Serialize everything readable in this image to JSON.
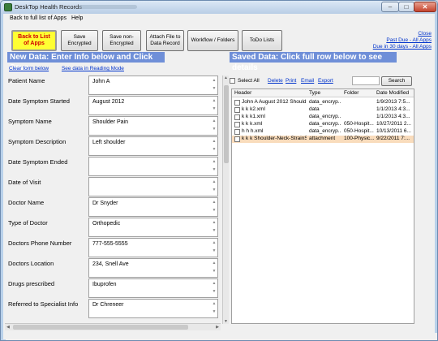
{
  "window": {
    "title": "DeskTop Health Records",
    "controls": {
      "minimize": "–",
      "maximize": "□",
      "close": "✕"
    }
  },
  "menu": [
    {
      "label": "Back to full list of Apps"
    },
    {
      "label": "Help"
    }
  ],
  "toolbar": {
    "back": "Back to List of Apps",
    "save_encrypted": "Save Encrypted",
    "save_non_encrypted": "Save non-Encrypted",
    "attach": "Attach File to Data Record",
    "workflow": "Workflow / Folders",
    "todo": "ToDo Lists"
  },
  "right_links": {
    "close": "Close",
    "past_due": "Past Due - All Apps",
    "due_30": "Due in 30 days - All Apps"
  },
  "new_data": {
    "banner": "New Data: Enter Info below and Click Save.",
    "clear_form": "Clear form below",
    "reading_mode": "See data in Reading Mode",
    "fields": [
      {
        "label": "Patient Name",
        "value": "John A"
      },
      {
        "label": "Date Symptom Started",
        "value": "August 2012"
      },
      {
        "label": "Symptom Name",
        "value": "Shoulder Pain"
      },
      {
        "label": "Symptom Description",
        "value": "Left shoulder"
      },
      {
        "label": "Date  Symptom Ended",
        "value": ""
      },
      {
        "label": "Date of Visit",
        "value": ""
      },
      {
        "label": "Doctor Name",
        "value": "Dr Snyder"
      },
      {
        "label": "Type of Doctor",
        "value": "Orthopedic"
      },
      {
        "label": "Doctors Phone Number",
        "value": "777-555-5555"
      },
      {
        "label": "Doctors Location",
        "value": "234, Snell Ave"
      },
      {
        "label": "Drugs prescribed",
        "value": "Ibuprofen"
      },
      {
        "label": "Referred to Specialist Info",
        "value": "Dr Chreneer"
      }
    ]
  },
  "saved_data": {
    "banner": "Saved Data: Click full row below to see details",
    "select_all": "Select All",
    "delete": "Delete",
    "print": "Print",
    "email": "Email",
    "export": "Export",
    "search_placeholder": "",
    "search_button": "Search",
    "columns": [
      "Header",
      "Type",
      "Folder",
      "Date Modified"
    ],
    "rows": [
      {
        "header": "John A August 2012 Should...",
        "type": "data_encryp...",
        "folder": "",
        "date": "1/9/2013 7:5...",
        "selected": false
      },
      {
        "header": "k k k2.xml",
        "type": "data",
        "folder": "",
        "date": "1/1/2013 4:3...",
        "selected": false
      },
      {
        "header": "k k k1.xml",
        "type": "data_encryp...",
        "folder": "",
        "date": "1/1/2013 4:3...",
        "selected": false
      },
      {
        "header": "k k k.xml",
        "type": "data_encryp...",
        "folder": "050-Hospit...",
        "date": "10/27/2011 2...",
        "selected": false
      },
      {
        "header": "h h h.xml",
        "type": "data_encryp...",
        "folder": "050-Hospit...",
        "date": "10/13/2011 6...",
        "selected": false
      },
      {
        "header": "k k k Shoulder-Neck-StrainS...",
        "type": "attachment",
        "folder": "100-Physic...",
        "date": "9/22/2011 7:...",
        "selected": true
      }
    ]
  },
  "colors": {
    "banner": "#6f8fd8",
    "back_button": "#ffff33",
    "back_text": "#d00000",
    "selected_row": "#f9dcbc",
    "link": "#0033cc"
  }
}
